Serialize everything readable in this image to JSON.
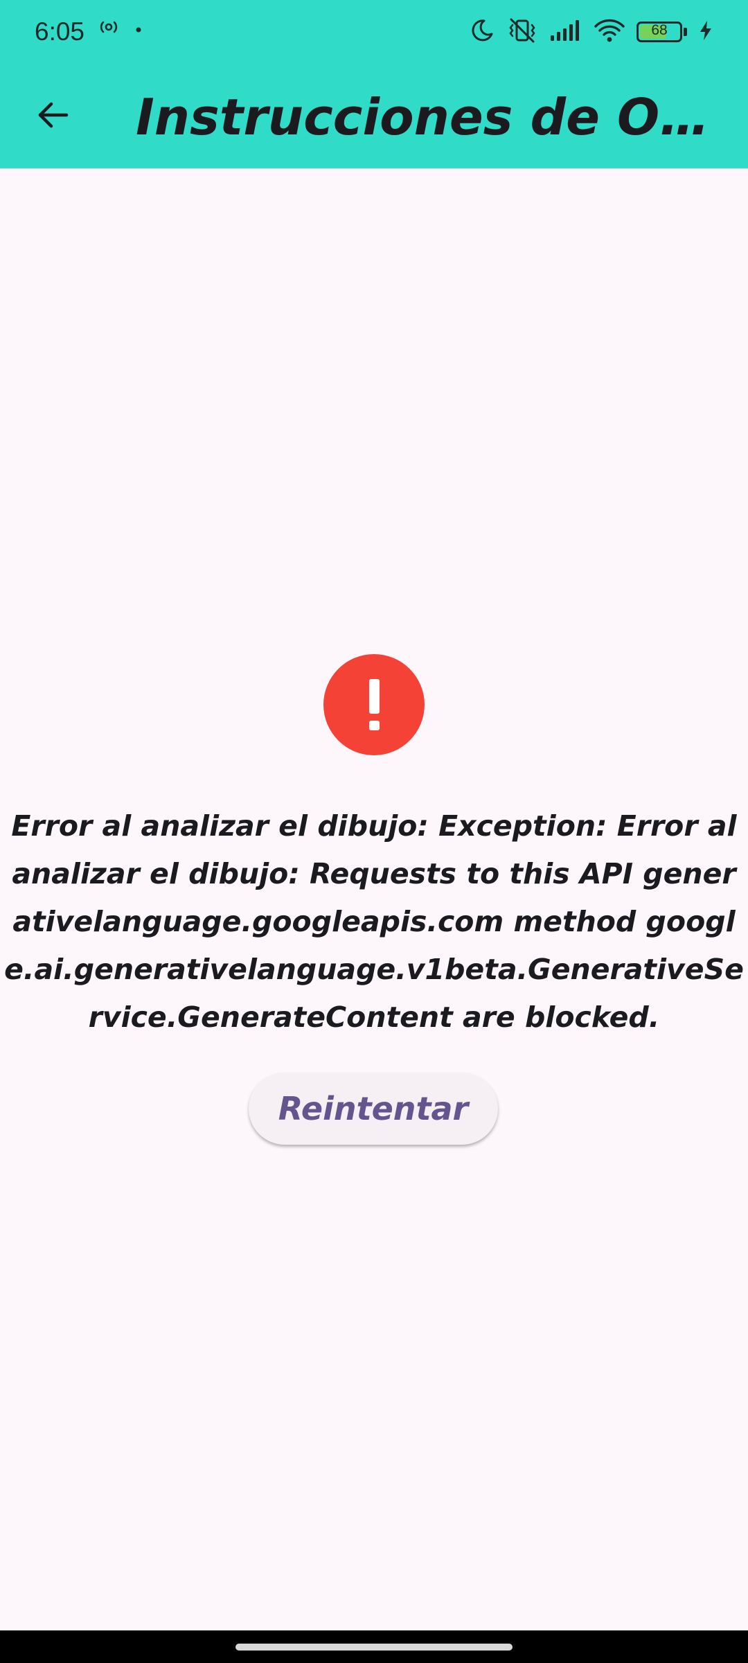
{
  "status_bar": {
    "time": "6:05",
    "battery_level": "68",
    "battery_fraction": 0.68,
    "left_icons": [
      "hotspot-icon",
      "dot-icon"
    ],
    "right_icons": [
      "moon-icon",
      "vibrate-muted-icon",
      "cell-signal-icon",
      "wifi-icon",
      "battery-icon",
      "charging-bolt-icon"
    ]
  },
  "app_bar": {
    "title": "Instrucciones de Orig...",
    "back_icon": "arrow-left-icon",
    "background": "#30dbc8"
  },
  "error": {
    "icon": "error-circle-icon",
    "icon_color": "#f44336",
    "message": "Error al analizar el dibujo: Exception: Error al analizar el dibujo: Requests to this API generativelanguage.googleapis.com method google.ai.generativelanguage.v1beta.GenerativeService.GenerateContent are blocked."
  },
  "retry_button": {
    "label": "Reintentar",
    "color": "#65558f"
  }
}
